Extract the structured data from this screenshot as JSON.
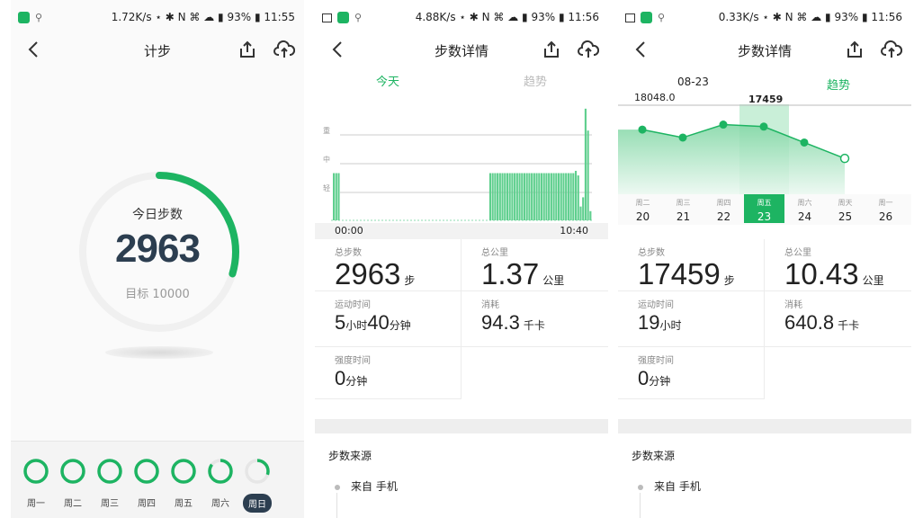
{
  "accent_color": "#1db462",
  "screens": [
    {
      "status": {
        "net_speed": "1.72K/s",
        "battery": "93%",
        "time": "11:55"
      },
      "title": "计步",
      "ring": {
        "label": "今日步数",
        "steps": "2963",
        "goal_label": "目标 10000",
        "progress_fraction": 0.2963
      },
      "week": [
        {
          "label": "周一",
          "progress_fraction": 1.0
        },
        {
          "label": "周二",
          "progress_fraction": 1.0
        },
        {
          "label": "周三",
          "progress_fraction": 1.0
        },
        {
          "label": "周四",
          "progress_fraction": 1.0
        },
        {
          "label": "周五",
          "progress_fraction": 1.0
        },
        {
          "label": "周六",
          "progress_fraction": 0.85
        },
        {
          "label": "周日",
          "progress_fraction": 0.3,
          "selected": true
        }
      ]
    },
    {
      "status": {
        "net_speed": "4.88K/s",
        "battery": "93%",
        "time": "11:56"
      },
      "title": "步数详情",
      "tabs": [
        {
          "label": "今天",
          "active": true
        },
        {
          "label": "趋势",
          "active": false
        }
      ],
      "chart": {
        "levels": [
          "重",
          "中",
          "轻"
        ],
        "x_start": "00:00",
        "x_end": "10:40",
        "bars_norm": [
          0.41,
          0.41,
          0.41,
          0,
          0,
          0,
          0,
          0,
          0,
          0,
          0,
          0,
          0,
          0,
          0,
          0,
          0,
          0,
          0,
          0,
          0,
          0,
          0,
          0,
          0,
          0,
          0,
          0,
          0,
          0,
          0,
          0,
          0,
          0,
          0,
          0,
          0,
          0,
          0,
          0,
          0,
          0,
          0,
          0,
          0,
          0,
          0,
          0,
          0,
          0,
          0,
          0,
          0,
          0,
          0,
          0,
          0,
          0,
          0,
          0,
          0,
          0,
          0,
          0,
          0.41,
          0.41,
          0.41,
          0.41,
          0.41,
          0.41,
          0.41,
          0.41,
          0.41,
          0.41,
          0.41,
          0.41,
          0.41,
          0.41,
          0.41,
          0.41,
          0.41,
          0.41,
          0.41,
          0.41,
          0.41,
          0.41,
          0.41,
          0.41,
          0.41,
          0.41,
          0.41,
          0.41,
          0.41,
          0.41,
          0.41,
          0.41,
          0.41,
          0.41,
          0.41,
          0.43,
          0.39,
          0.12,
          0.2,
          0.97,
          0.78,
          0.08
        ]
      },
      "stats": {
        "total_steps_label": "总步数",
        "total_steps": "2963",
        "steps_unit": "步",
        "distance_label": "总公里",
        "distance": "1.37",
        "distance_unit": "公里",
        "duration_label": "运动时间",
        "duration_h": "5",
        "hour_unit": "小时",
        "duration_m": "40",
        "minute_unit": "分钟",
        "calories_label": "消耗",
        "calories": "94.3",
        "calories_unit": "千卡",
        "intensity_label": "强度时间",
        "intensity_m": "0",
        "intensity_unit": "分钟"
      },
      "source_title": "步数来源",
      "source_item": "来自 手机"
    },
    {
      "status": {
        "net_speed": "0.33K/s",
        "battery": "93%",
        "time": "11:56"
      },
      "title": "步数详情",
      "tabs": [
        {
          "label": "08-23",
          "active": false
        },
        {
          "label": "趋势",
          "active": true
        }
      ],
      "trend": {
        "max_label": "18048.0",
        "selected_value": "17459",
        "points": [
          15600,
          14800,
          16100,
          15900,
          14300,
          12700
        ],
        "days": [
          {
            "wk": "周二",
            "d": "20"
          },
          {
            "wk": "周三",
            "d": "21"
          },
          {
            "wk": "周四",
            "d": "22"
          },
          {
            "wk": "周五",
            "d": "23",
            "selected": true
          },
          {
            "wk": "周六",
            "d": "24"
          },
          {
            "wk": "周天",
            "d": "25"
          },
          {
            "wk": "周一",
            "d": "26"
          }
        ]
      },
      "stats": {
        "total_steps_label": "总步数",
        "total_steps": "17459",
        "steps_unit": "步",
        "distance_label": "总公里",
        "distance": "10.43",
        "distance_unit": "公里",
        "duration_label": "运动时间",
        "duration_h": "19",
        "hour_unit": "小时",
        "calories_label": "消耗",
        "calories": "640.8",
        "calories_unit": "千卡",
        "intensity_label": "强度时间",
        "intensity_m": "0",
        "intensity_unit": "分钟"
      },
      "source_title": "步数来源",
      "source_item": "来自 手机"
    }
  ]
}
